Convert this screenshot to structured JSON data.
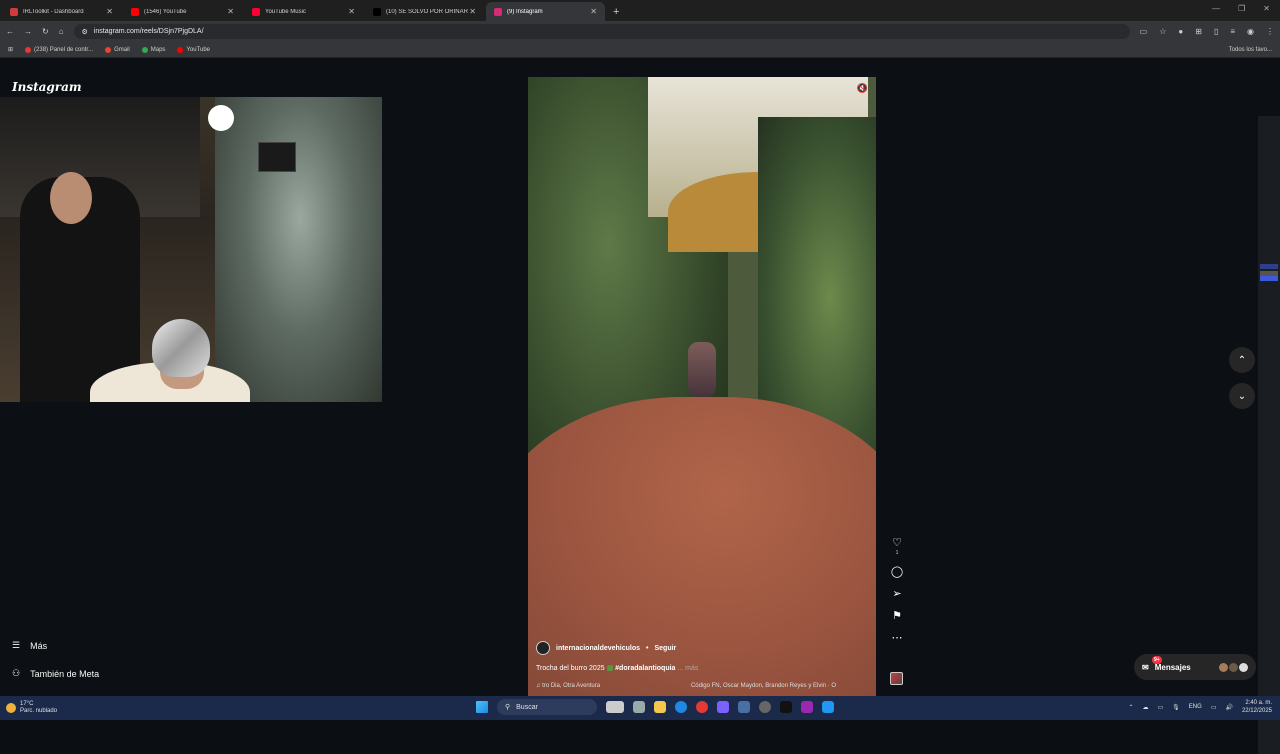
{
  "browser": {
    "tabs": [
      {
        "title": "IRLToolkit - Dashboard",
        "color": "#d23b3b",
        "active": false
      },
      {
        "title": "(1546) YouTube",
        "color": "#ff0000",
        "active": false
      },
      {
        "title": "YouTube Music",
        "color": "#ff0033",
        "active": false
      },
      {
        "title": "(10) SE SOLVO POR ORINAR - ...",
        "color": "#000000",
        "active": false
      },
      {
        "title": "(9) Instagram",
        "color": "#d62976",
        "active": true
      }
    ],
    "new_tab": "+",
    "url": "instagram.com/reels/DSjn7PjgDLA/",
    "bookmarks": [
      {
        "label": "(238) Panel de contr...",
        "color": "#e53935"
      },
      {
        "label": "Gmail",
        "color": "#ea4335"
      },
      {
        "label": "Maps",
        "color": "#34a853"
      },
      {
        "label": "YouTube",
        "color": "#ff0000"
      }
    ],
    "all_bookmarks": "Todos los favo..."
  },
  "instagram": {
    "logo": "Instagram",
    "nav": {
      "more": "Más",
      "also_meta": "También de Meta"
    },
    "reel": {
      "account": "internacionaldevehiculos",
      "follow": "Seguir",
      "caption": "Trocha del burro 2025",
      "hashtag": "#doradalantioquia",
      "more": "... más",
      "audio": "tro Dia, Otra Aventura",
      "credits": "Código FN, Oscar Maydon, Brandon Reyes y Elvin · O",
      "like_count": "1"
    },
    "messages": {
      "label": "Mensajes",
      "badge": "9+"
    }
  },
  "taskbar": {
    "temperature": "17°C",
    "weather": "Parc. nublado",
    "search_placeholder": "Buscar",
    "language": "ENG",
    "time": "2:40 a. m.",
    "date": "22/12/2025"
  }
}
